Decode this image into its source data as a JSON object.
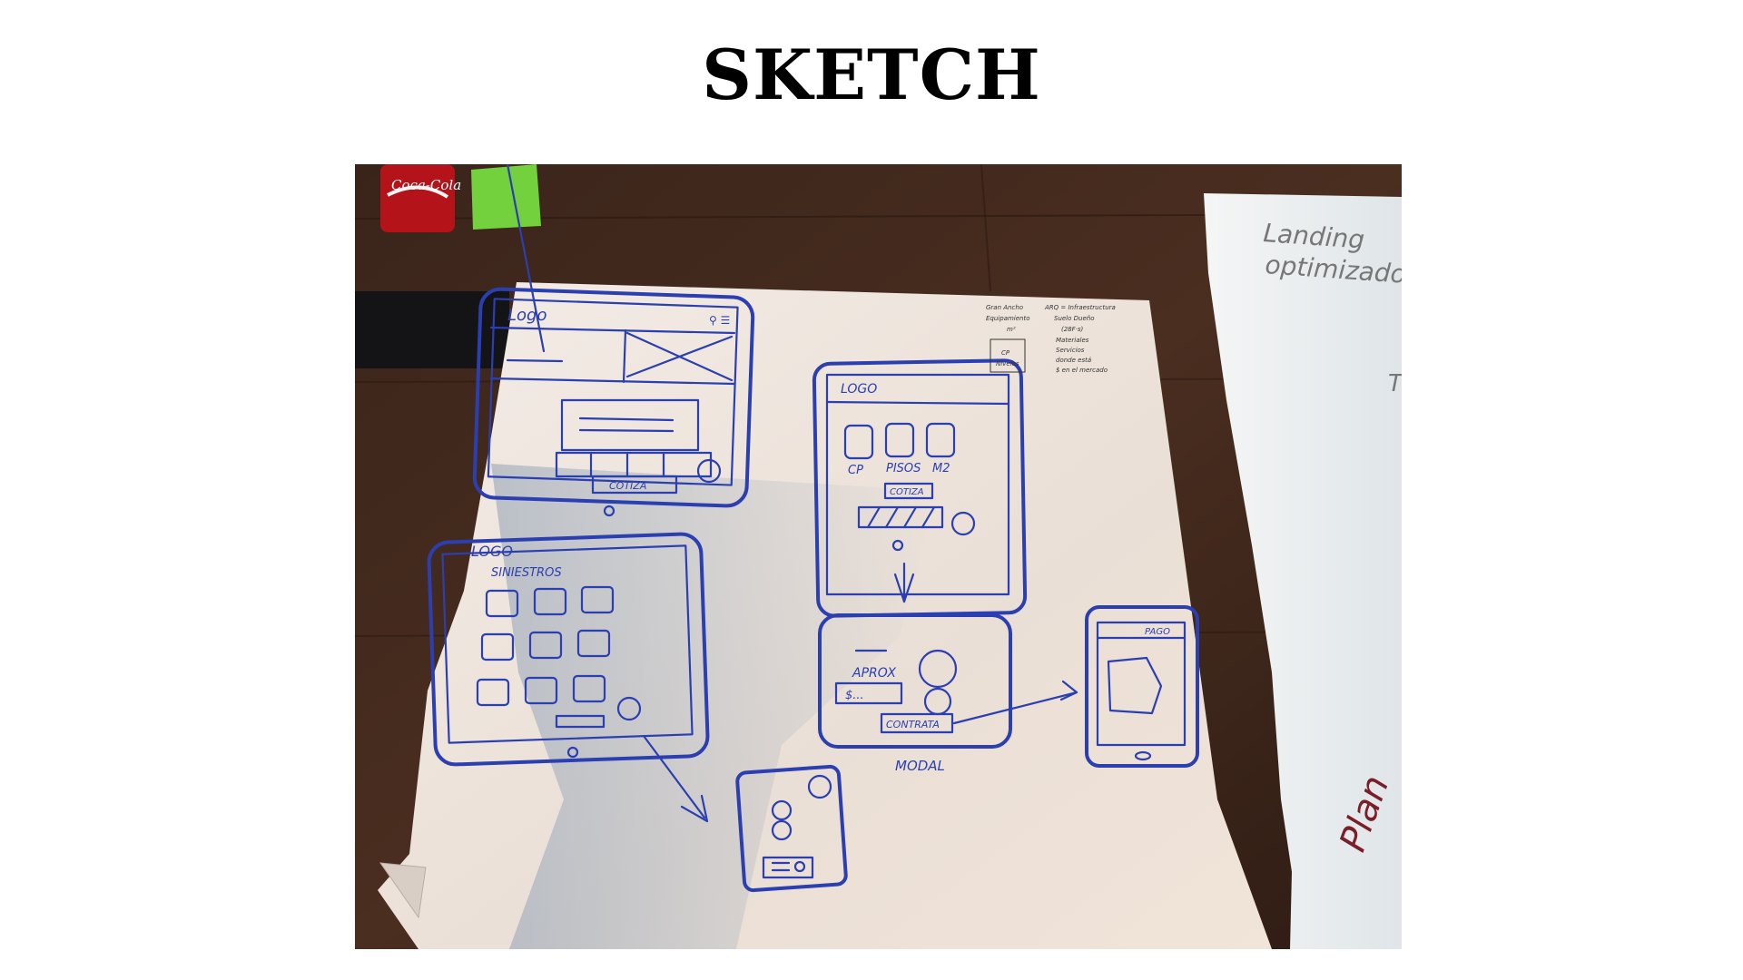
{
  "title": "SKETCH",
  "photo": {
    "can_label": "Coca-Cola",
    "side_sheet": {
      "line1": "Landing",
      "line2": "optimizado",
      "handwriting": "Plan",
      "letter": "T"
    },
    "wireframe1": {
      "logo": "Logo",
      "cta": "COTIZA"
    },
    "wireframe2": {
      "logo": "LOGO",
      "fields": [
        "CP",
        "PISOS",
        "M2"
      ],
      "cta": "COTIZA"
    },
    "wireframe3": {
      "logo": "LOGO",
      "heading": "SINIESTROS"
    },
    "modal": {
      "label": "MODAL",
      "price_label": "APROX",
      "price": "$...",
      "cta": "CONTRATA"
    },
    "wireframe5": {
      "badge": "PAGO"
    },
    "notes": {
      "col1": [
        "Gran Ancho",
        "Equipamiento",
        "m²",
        "CP",
        "Niveles"
      ],
      "col2": [
        "ARQ = Infraestructura",
        "Suelo Dueño",
        "(28F·s)",
        "Materiales",
        "Servicios",
        "donde está",
        "$ en el mercado"
      ]
    }
  }
}
